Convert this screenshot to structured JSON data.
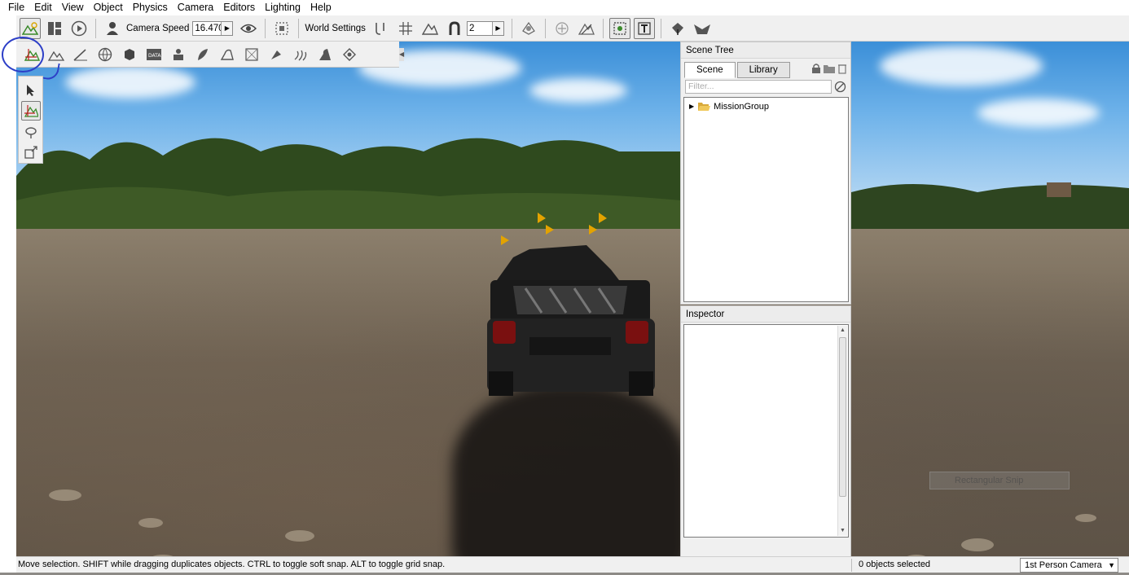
{
  "menu": [
    "File",
    "Edit",
    "View",
    "Object",
    "Physics",
    "Camera",
    "Editors",
    "Lighting",
    "Help"
  ],
  "toolbar": {
    "camera_speed_label": "Camera Speed",
    "camera_speed_value": "16.470",
    "world_settings_label": "World Settings",
    "snap_value": "2"
  },
  "scene_tree": {
    "title": "Scene Tree",
    "tabs": [
      "Scene",
      "Library"
    ],
    "active_tab": "Scene",
    "filter_placeholder": "Filter...",
    "items": [
      {
        "label": "MissionGroup",
        "expanded": false
      }
    ]
  },
  "inspector": {
    "title": "Inspector"
  },
  "viewport": {
    "hud_ghost_text": "Rectangular Snip"
  },
  "status": {
    "message": "Move selection.  SHIFT while dragging duplicates objects.  CTRL to toggle soft snap.  ALT to toggle grid snap.",
    "selection_count": "0 objects selected",
    "camera_mode": "1st Person Camera"
  },
  "colors": {
    "annotation": "#2d3fc7",
    "panel_bg": "#f0f0f0",
    "sky": "#6fb3ea"
  }
}
